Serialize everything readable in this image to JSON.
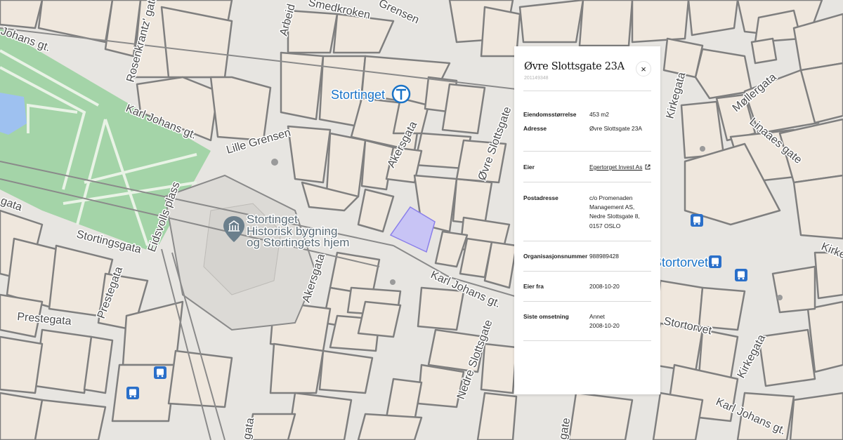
{
  "map": {
    "labels": {
      "street_1": "Johans gt.",
      "street_2": "Rosenkrantz' gate",
      "street_3": "Arbeid",
      "street_4": "Smedkroken",
      "street_5": "Grensen",
      "street_6": "Karl Johans gt.",
      "street_7": "Lille Grensen",
      "street_8": "Akersgata",
      "street_9": "Øvre Slottsgate",
      "street_10": "Kirkegata",
      "street_11": "Møllergata",
      "street_12": "Linaaes gate",
      "street_13": "Eidsvolls plass",
      "street_14": "Stortingsgata",
      "street_15": "Prestegata",
      "street_16": "Prestegata",
      "street_17": "gata",
      "street_18": "Akersgata",
      "street_19": "Karl Johans gt.",
      "street_20": "Nedre Slottsgate",
      "street_21": "Stortorvet",
      "street_22": "Kirkegata",
      "street_23": "Karl Johans gt.",
      "street_24": "Kirke",
      "street_25": "gata",
      "street_26": "gate",
      "station": "Stortinget",
      "poi_title": "Stortinget",
      "poi_line1": "Historisk bygning",
      "poi_line2": "og Stortingets hjem",
      "square": "Stortorvet"
    },
    "colors": {
      "background": "#e7e5e1",
      "park": "#a4d4a8",
      "water": "#9ec1f0",
      "parcel_fill": "#efe7dd",
      "parcel_border": "#7f7f7f",
      "selected_parcel": "#c8c4f5",
      "selected_parcel_border": "#8a7fea",
      "transit_blue": "#2a6fc9"
    },
    "icons": [
      "metro-station-icon",
      "landmark-icon",
      "bus-stop-icon",
      "map-pin-icon"
    ]
  },
  "panel": {
    "title": "Øvre Slottsgate 23A",
    "subtitle": "201149348",
    "close_label": "×",
    "eiendom_label": "Eiendomsstørrelse",
    "eiendom_value": "453 m2",
    "adresse_label": "Adresse",
    "adresse_value": "Øvre Slottsgate 23A",
    "eier_label": "Eier",
    "eier_value": "Egertorget Invest As",
    "postadresse_label": "Postadresse",
    "postadresse_line1": "c/o Promenaden",
    "postadresse_line2": "Management AS,",
    "postadresse_line3": "Nedre Slottsgate 8,",
    "postadresse_line4": "0157 OSLO",
    "orgnr_label": "Organisasjonsnummer",
    "orgnr_value": "988989428",
    "eier_fra_label": "Eier fra",
    "eier_fra_value": "2008-10-20",
    "omsetning_label": "Siste omsetning",
    "omsetning_line1": "Annet",
    "omsetning_line2": "2008-10-20"
  }
}
